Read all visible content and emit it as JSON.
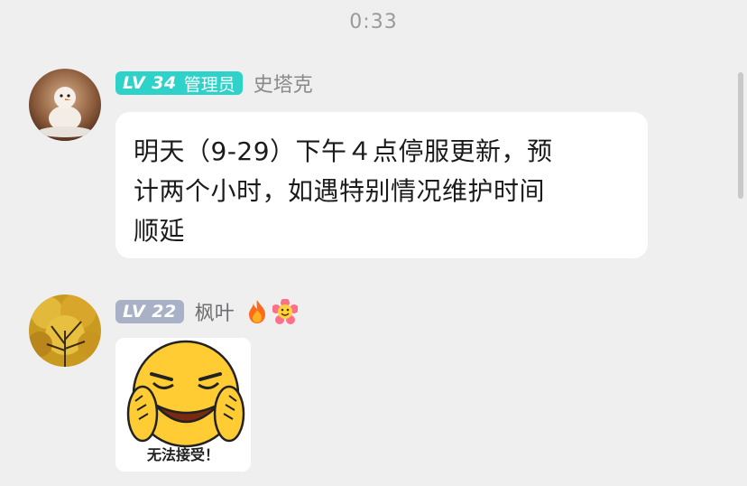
{
  "timestamp": "0:33",
  "messages": [
    {
      "level": "LV 34",
      "role": "管理员",
      "name": "史塔克",
      "text_lines": [
        "明天（9-29）下午４点停服更新，预",
        "计两个小时，如遇特别情况维护时间",
        "顺延"
      ]
    },
    {
      "level": "LV 22",
      "name": "枫叶",
      "badges": [
        "fire-icon",
        "smiley-flower-icon"
      ],
      "sticker_caption": "无法接受！"
    }
  ],
  "colors": {
    "admin_level_badge": "#2fd2c8",
    "member_level_badge": "#a9b1c6",
    "bubble": "#ffffff",
    "background": "#efeff0"
  }
}
